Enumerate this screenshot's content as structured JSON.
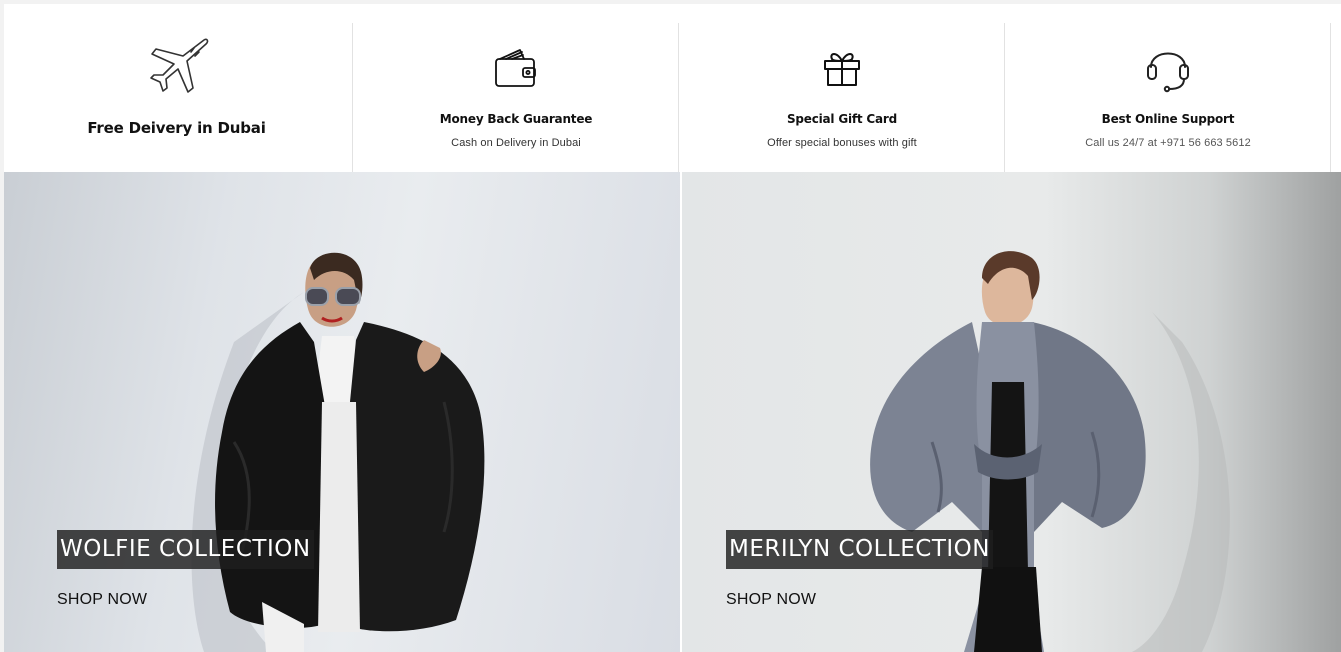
{
  "features": [
    {
      "icon": "airplane-icon",
      "title": "Free Deivery in Dubai",
      "subtitle": ""
    },
    {
      "icon": "wallet-icon",
      "title": "Money Back Guarantee",
      "subtitle": "Cash on Delivery in Dubai"
    },
    {
      "icon": "gift-icon",
      "title": "Special Gift Card",
      "subtitle": "Offer special bonuses with gift"
    },
    {
      "icon": "headset-icon",
      "title": "Best Online Support",
      "subtitle": "Call us 24/7 at +971 56 663 5612"
    }
  ],
  "collections": [
    {
      "title": "WOLFIE COLLECTION",
      "cta": "SHOP NOW"
    },
    {
      "title": "MERILYN COLLECTION",
      "cta": "SHOP NOW"
    }
  ]
}
